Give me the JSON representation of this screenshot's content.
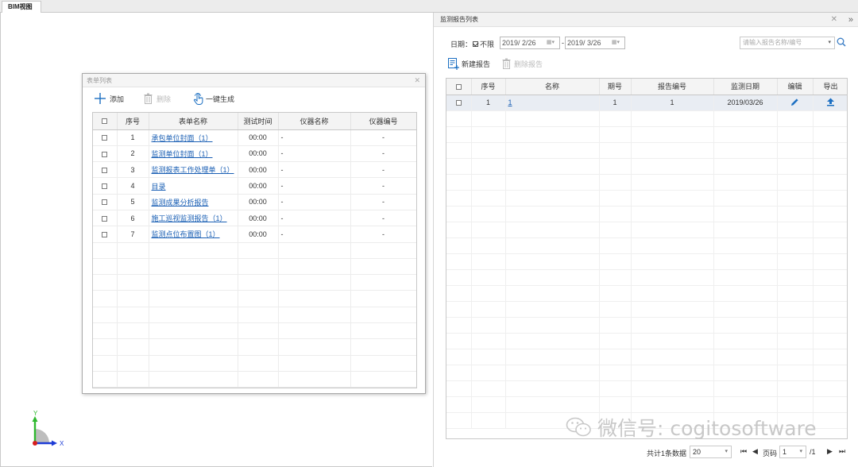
{
  "tab": {
    "label": "BIM视图"
  },
  "dialog": {
    "title": "表单列表",
    "toolbar": {
      "add": "添加",
      "delete": "删除",
      "generate": "一键生成"
    },
    "columns": [
      "序号",
      "表单名称",
      "测试时间",
      "仪器名称",
      "仪器编号"
    ],
    "rows": [
      {
        "no": "1",
        "name": "承包单位封面（1）",
        "time": "00:00",
        "instrument": "-",
        "code": "-"
      },
      {
        "no": "2",
        "name": "监测单位封面（1）",
        "time": "00:00",
        "instrument": "-",
        "code": "-"
      },
      {
        "no": "3",
        "name": "监测报表工作处理单（1）",
        "time": "00:00",
        "instrument": "-",
        "code": "-"
      },
      {
        "no": "4",
        "name": "目录",
        "time": "00:00",
        "instrument": "-",
        "code": "-"
      },
      {
        "no": "5",
        "name": "监测成果分析报告",
        "time": "00:00",
        "instrument": "-",
        "code": "-"
      },
      {
        "no": "6",
        "name": "施工巡视监测报告（1）",
        "time": "00:00",
        "instrument": "-",
        "code": "-"
      },
      {
        "no": "7",
        "name": "监测点位布置图（1）",
        "time": "00:00",
        "instrument": "-",
        "code": "-"
      }
    ]
  },
  "axis": {
    "y": "Y",
    "x": "X"
  },
  "panel": {
    "title": "监测报告列表",
    "filter": {
      "date_label": "日期：",
      "unlimited": "不限",
      "start_date": "2019/ 2/26",
      "end_date": "2019/ 3/26",
      "separator": "-",
      "search_placeholder": "请输入报告名称/编号"
    },
    "toolbar": {
      "new_report": "新建报告",
      "delete_report": "删除报告"
    },
    "columns": [
      "序号",
      "名称",
      "期号",
      "报告编号",
      "监测日期",
      "编辑",
      "导出"
    ],
    "rows": [
      {
        "no": "1",
        "name": "1",
        "period": "1",
        "report_no": "1",
        "date": "2019/03/26"
      }
    ],
    "pager": {
      "total": "共计1条数据",
      "page_size": "20",
      "page_label": "页码",
      "page": "1",
      "of": "/1"
    }
  },
  "watermark": {
    "text": "微信号: cogitosoftware"
  }
}
